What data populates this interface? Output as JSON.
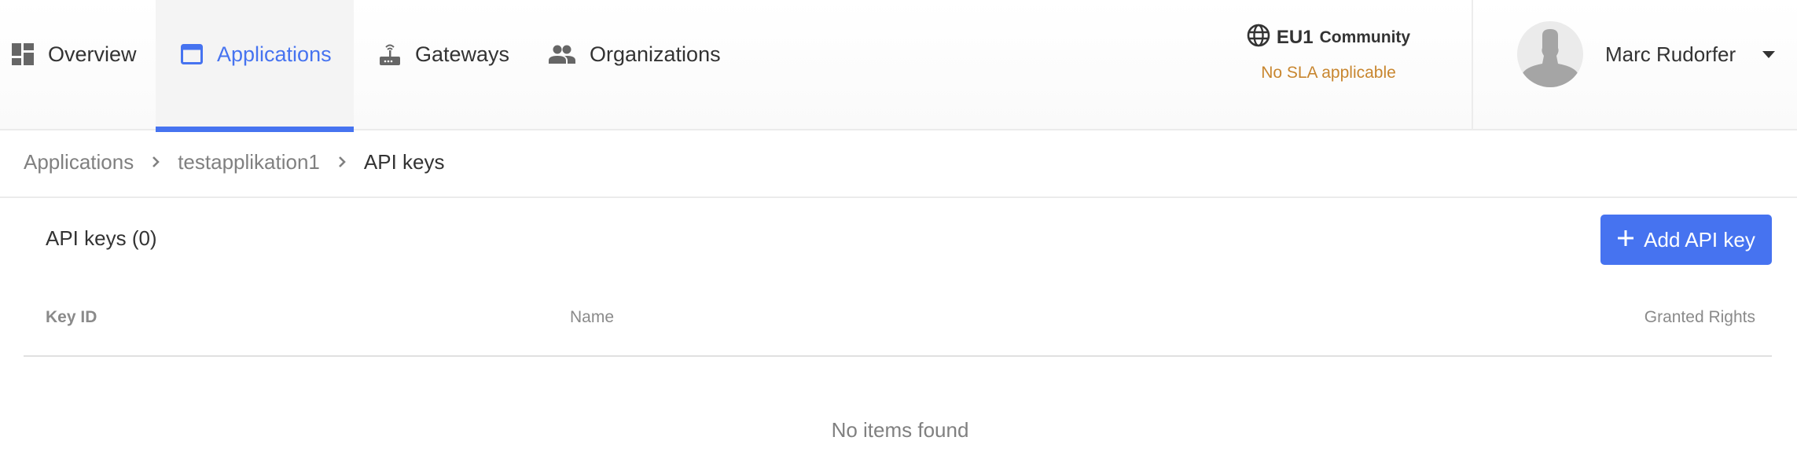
{
  "nav": {
    "items": [
      {
        "label": "Overview",
        "icon": "dashboard-icon",
        "active": false
      },
      {
        "label": "Applications",
        "icon": "application-window-icon",
        "active": true
      },
      {
        "label": "Gateways",
        "icon": "router-icon",
        "active": false
      },
      {
        "label": "Organizations",
        "icon": "people-icon",
        "active": false
      }
    ]
  },
  "cluster": {
    "region": "EU1",
    "tier": "Community",
    "sla": "No SLA applicable",
    "icon": "globe-icon"
  },
  "user": {
    "name": "Marc Rudorfer",
    "avatar_icon": "default-avatar-icon",
    "menu_icon": "caret-down-icon"
  },
  "breadcrumb": [
    {
      "label": "Applications"
    },
    {
      "label": "testapplikation1"
    },
    {
      "label": "API keys"
    }
  ],
  "section": {
    "title": "API keys (0)",
    "add_button": "Add API key"
  },
  "table": {
    "columns": [
      "Key ID",
      "Name",
      "Granted Rights"
    ],
    "rows": [],
    "empty_message": "No items found"
  },
  "colors": {
    "accent": "#4673f0",
    "sla": "#c8862f",
    "muted_text": "#808080",
    "text": "#333333"
  }
}
